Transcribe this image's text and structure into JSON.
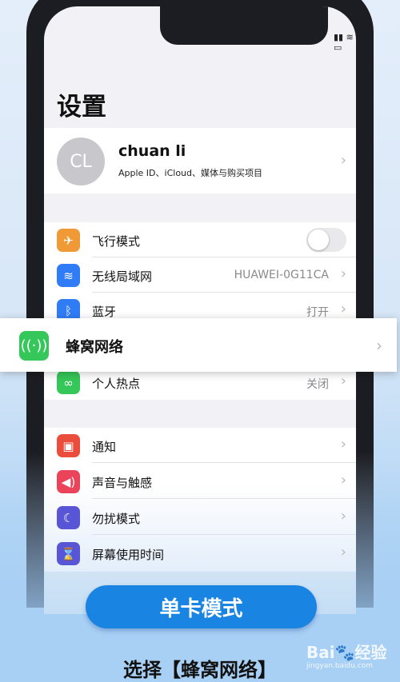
{
  "status": {
    "icons": "signal-wifi-battery"
  },
  "page_title": "设置",
  "profile": {
    "initials": "CL",
    "name": "chuan li",
    "subtitle": "Apple ID、iCloud、媒体与购买项目"
  },
  "rows": [
    {
      "label": "飞行模式",
      "icon": "airplane-icon",
      "color": "#f09a37",
      "toggle": false
    },
    {
      "label": "无线局域网",
      "value": "HUAWEI-0G11CA",
      "icon": "wifi-icon",
      "color": "#2f7cf6"
    },
    {
      "label": "蓝牙",
      "value": "打开",
      "icon": "bluetooth-icon",
      "color": "#2f7cf6"
    },
    {
      "label": "个人热点",
      "value": "关闭",
      "icon": "hotspot-icon",
      "color": "#35c759"
    },
    {
      "label": "通知",
      "icon": "notification-icon",
      "color": "#eb4d3d"
    },
    {
      "label": "声音与触感",
      "icon": "sound-icon",
      "color": "#eb445a"
    },
    {
      "label": "勿扰模式",
      "icon": "moon-icon",
      "color": "#5856d6"
    },
    {
      "label": "屏幕使用时间",
      "icon": "hourglass-icon",
      "color": "#5856d6"
    }
  ],
  "popup": {
    "label": "蜂窝网络",
    "icon": "cellular-icon",
    "color": "#35c759"
  },
  "button": "单卡模式",
  "caption": "选择【蜂窝网络】",
  "watermark": {
    "brand": "Bai🐾经验",
    "url": "jingyan.baidu.com"
  }
}
